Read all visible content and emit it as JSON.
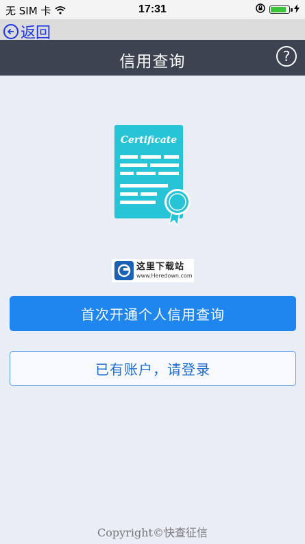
{
  "status_bar": {
    "carrier": "无 SIM 卡",
    "time": "17:31",
    "battery_level": 0.85,
    "battery_color": "#3cc43c"
  },
  "back": {
    "label": "返回"
  },
  "header": {
    "title": "信用查询",
    "help_symbol": "?"
  },
  "certificate": {
    "text": "Certificate",
    "color": "#27c3d6"
  },
  "watermark": {
    "title": "这里下载站",
    "url": "www.Heredown.com"
  },
  "primary_button": {
    "label": "首次开通个人信用查询",
    "color": "#1e86ee"
  },
  "secondary_button": {
    "label": "已有账户，请登录"
  },
  "footer": {
    "copyright": "Copyright©快查征信"
  }
}
